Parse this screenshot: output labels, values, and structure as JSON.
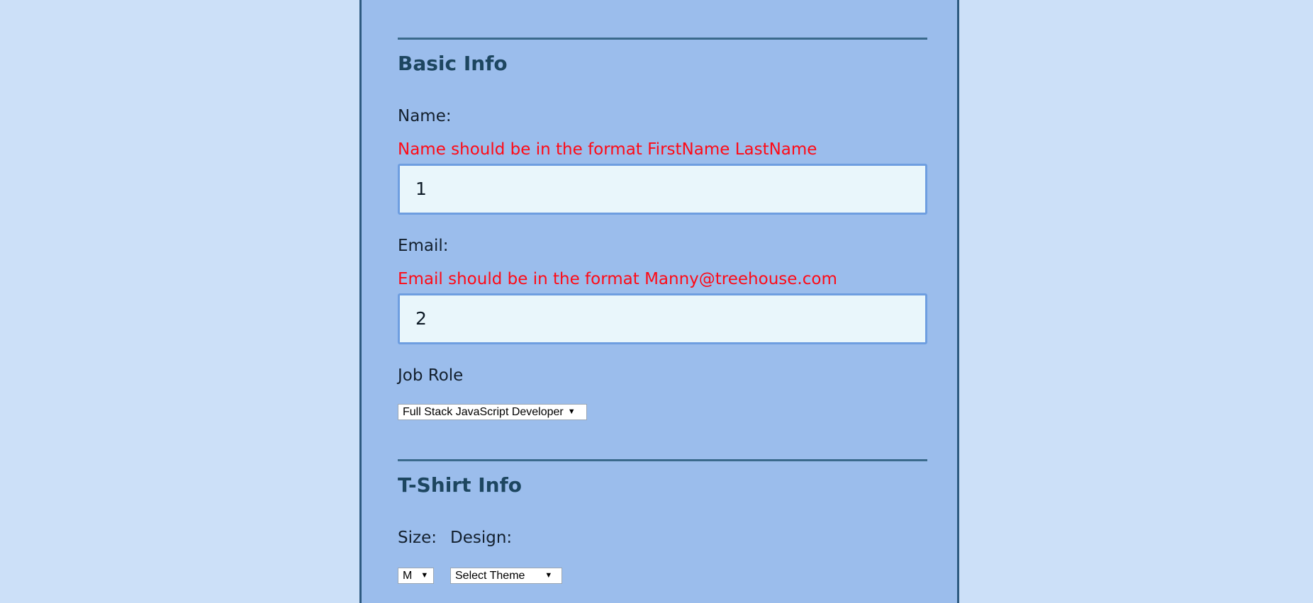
{
  "basic_info": {
    "title": "Basic Info",
    "name_label": "Name:",
    "name_error": "Name should be in the format FirstName LastName",
    "name_value": "1",
    "email_label": "Email:",
    "email_error": "Email should be in the format Manny@treehouse.com",
    "email_value": "2",
    "job_role_label": "Job Role",
    "job_role_selected": "Full Stack JavaScript Developer"
  },
  "tshirt_info": {
    "title": "T-Shirt Info",
    "size_label": "Size:",
    "size_selected": "M",
    "design_label": "Design:",
    "design_selected": "Select Theme"
  },
  "icons": {
    "dropdown_arrow": "chevron-down-icon"
  },
  "colors": {
    "page_background": "#cce0f8",
    "form_background": "#9bbdec",
    "error_text": "#ff0a16",
    "heading_text": "#1d4660",
    "input_background": "#e9f6fb",
    "input_border": "#6e9ee0"
  }
}
